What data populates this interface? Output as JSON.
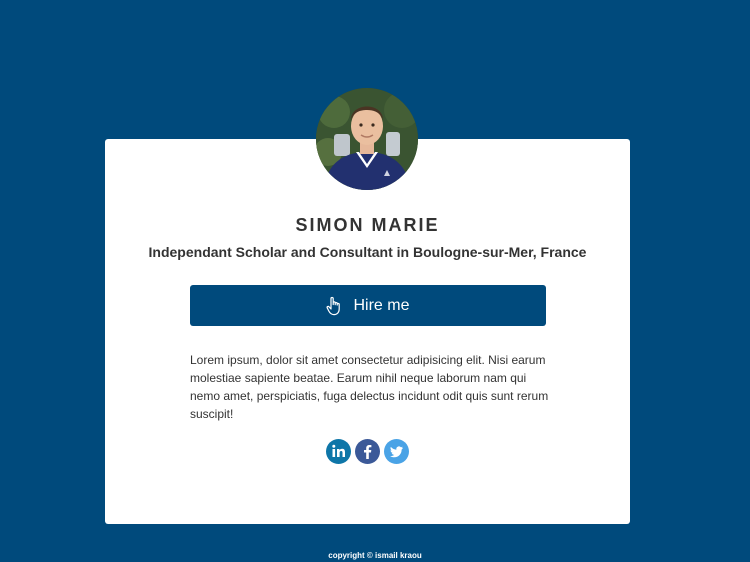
{
  "profile": {
    "name": "SIMON MARIE",
    "title": "Independant Scholar and Consultant in Boulogne-sur-Mer, France",
    "avatar_icon": "person-photo",
    "hire_label": "Hire me",
    "hire_icon": "hand-pointer-icon",
    "bio": "Lorem ipsum, dolor sit amet consectetur adipisicing elit. Nisi earum molestiae sapiente beatae. Earum nihil neque laborum nam qui nemo amet, perspiciatis, fuga delectus incidunt odit quis sunt rerum suscipit!"
  },
  "social": [
    {
      "name": "linkedin",
      "icon": "linkedin-icon",
      "color": "#0e76a8"
    },
    {
      "name": "facebook",
      "icon": "facebook-icon",
      "color": "#3b5998"
    },
    {
      "name": "twitter",
      "icon": "twitter-icon",
      "color": "#4aa3e6"
    }
  ],
  "footer": {
    "text": "copyright © ismail kraou"
  },
  "colors": {
    "background": "#004a7c",
    "card": "#ffffff",
    "text": "#333333"
  }
}
